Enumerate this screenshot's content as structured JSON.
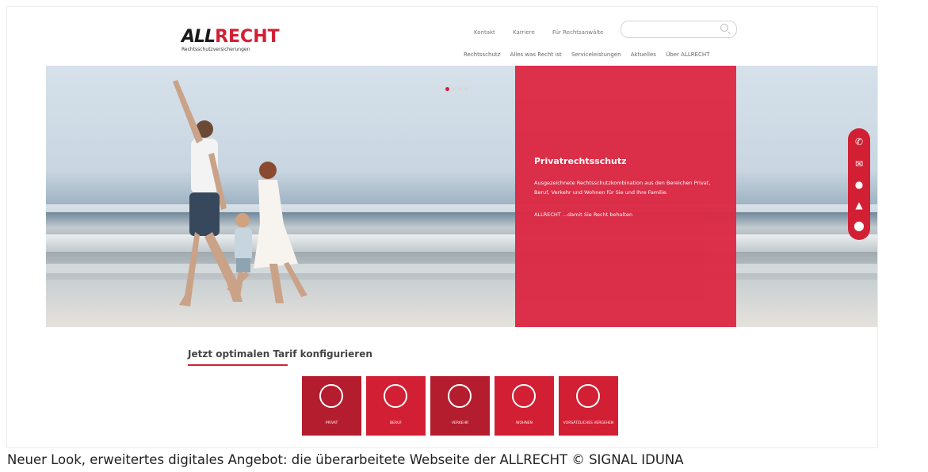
{
  "header": {
    "logo_text_black": "ALL",
    "logo_text_red": "RECHT",
    "logo_subline": "Rechtsschutzversicherungen",
    "top_links": [
      "Kontakt",
      "Karriere",
      "Für Rechtsanwälte"
    ],
    "search_placeholder": "",
    "main_nav": [
      "Rechtsschutz",
      "Alles was Recht ist",
      "Serviceleistungen",
      "Aktuelles",
      "Über ALLRECHT"
    ]
  },
  "hero": {
    "slide_count": 4,
    "active_slide": 1,
    "panel_title": "Privatrechtsschutz",
    "panel_desc": "Ausgezeichnete Rechtsschutzkombination aus den Bereichen Privat, Beruf, Verkehr und Wohnen für Sie und Ihre Familie.",
    "panel_tagline": "ALLRECHT ...damit Sie Recht behalten"
  },
  "sidebar": {
    "icons": [
      "phone-icon",
      "mail-icon",
      "person-icon",
      "warning-icon",
      "location-icon"
    ]
  },
  "tarif": {
    "title": "Jetzt optimalen Tarif konfigurieren",
    "tiles": [
      {
        "label": "PRIVAT",
        "icon": "family-icon"
      },
      {
        "label": "BERUF",
        "icon": "briefcase-icon"
      },
      {
        "label": "VERKEHR",
        "icon": "car-icon"
      },
      {
        "label": "WOHNEN",
        "icon": "house-icon"
      },
      {
        "label": "VORSÄTZLICHES VERGEHEN",
        "icon": "courthouse-icon"
      }
    ]
  },
  "caption": "Neuer Look, erweitertes digitales Angebot: die überarbeitete Webseite der ALLRECHT  © SIGNAL IDUNA",
  "colors": {
    "brand_red": "#d21f33",
    "panel_red": "#dc2a45",
    "dark_red": "#b41d2e"
  }
}
